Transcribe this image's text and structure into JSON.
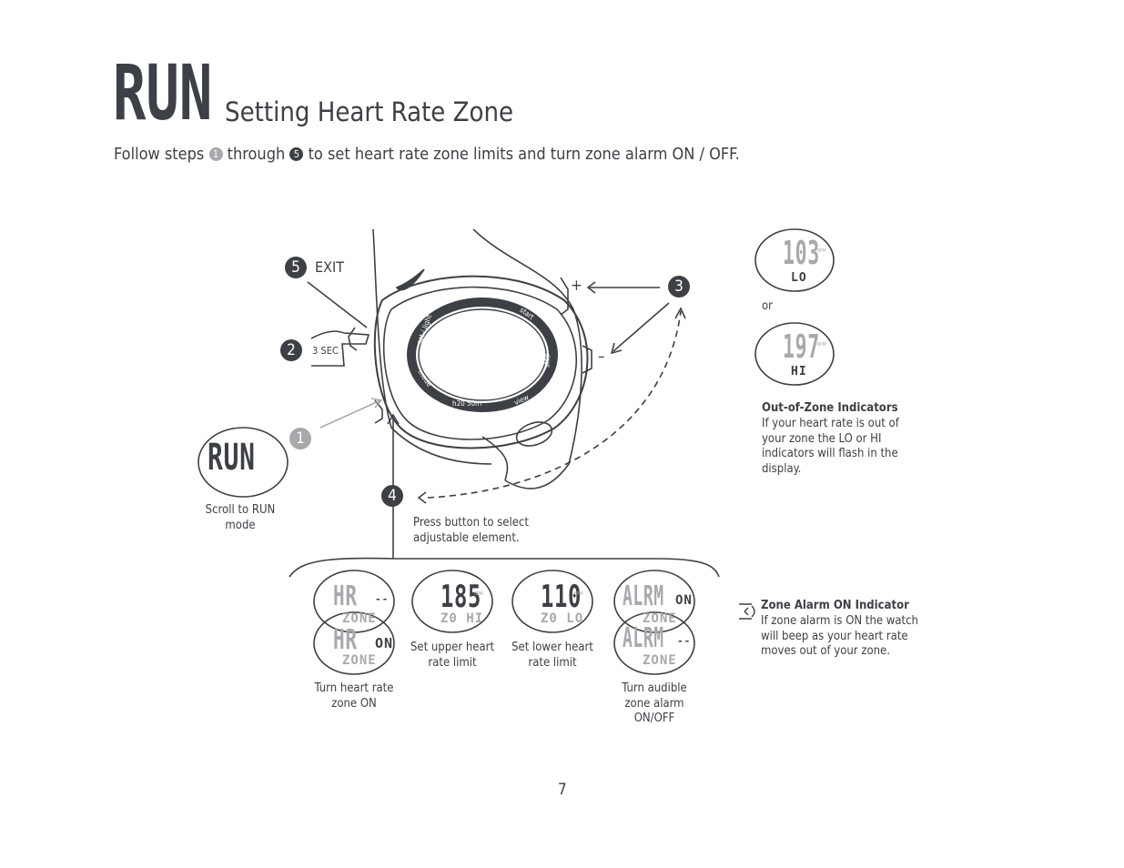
{
  "header": {
    "mode_logo": "RUN",
    "title": "Setting Heart Rate Zone"
  },
  "intro": {
    "before": "Follow steps",
    "step_start": "1",
    "middle": "through",
    "step_end": "5",
    "after": "to set heart rate zone limits and turn zone alarm ON / OFF."
  },
  "watch": {
    "bezel": {
      "set_light": "set / light",
      "start": "start",
      "stop": "stop",
      "mode": "mode",
      "view": "view",
      "water": "h20 50m"
    },
    "plus": "+",
    "minus": "–"
  },
  "steps": [
    {
      "n": "1",
      "label": "Scroll to RUN mode",
      "display": "RUN"
    },
    {
      "n": "2",
      "label": "3 SEC"
    },
    {
      "n": "3"
    },
    {
      "n": "4",
      "label": "Press button to select adjustable element."
    },
    {
      "n": "5",
      "label": "EXIT"
    }
  ],
  "colors": {
    "ink": "#3d4045",
    "step1": "#a7a9ac",
    "lcd_light": "#a7a9ac"
  },
  "displays": [
    {
      "top": "HR",
      "top_right": "--",
      "bottom": "ZONE",
      "top2": "HR",
      "top_right2": "ON",
      "bottom2": "ZONE",
      "caption": "Turn heart rate zone ON"
    },
    {
      "value": "185",
      "unit": "BPM",
      "bottom": "Z0 HI",
      "caption": "Set upper heart rate limit"
    },
    {
      "value": "110",
      "unit": "BPM",
      "bottom": "Z0 LO",
      "caption": "Set lower heart rate limit"
    },
    {
      "top": "ALRM",
      "top_right": "ON",
      "bottom": "ZONE",
      "top2": "ALRM",
      "top_right2": "--",
      "bottom2": "ZONE",
      "caption": "Turn audible zone alarm ON/OFF"
    }
  ],
  "out_of_zone": {
    "lo_value": "103",
    "lo_label": "LO",
    "or": "or",
    "hi_value": "197",
    "hi_label": "HI",
    "unit": "BPM",
    "title": "Out-of-Zone Indicators",
    "text": "If your heart rate is out of your zone the LO or HI indicators will flash in the display."
  },
  "alarm_indicator": {
    "title": "Zone Alarm ON Indicator",
    "text": "If zone alarm is ON the watch will beep as your heart rate moves out of your zone.",
    "icon": "speaker-icon"
  },
  "page_number": "7"
}
